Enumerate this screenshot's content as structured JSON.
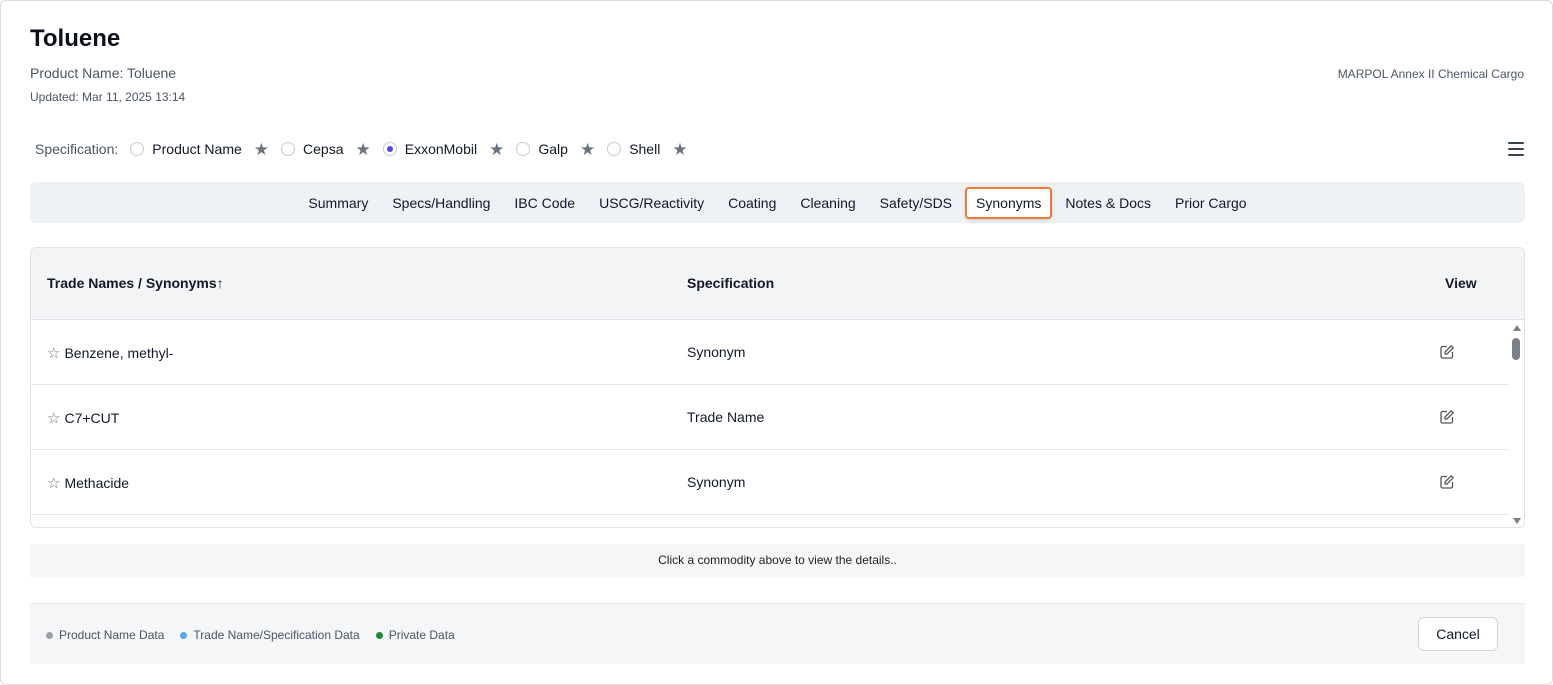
{
  "header": {
    "title": "Toluene",
    "product_name": "Product Name: Toluene",
    "updated": "Updated: Mar 11, 2025 13:14",
    "category": "MARPOL Annex II Chemical Cargo"
  },
  "specification": {
    "label": "Specification:",
    "options": [
      {
        "label": "Product Name",
        "checked": false
      },
      {
        "label": "Cepsa",
        "checked": false
      },
      {
        "label": "ExxonMobil",
        "checked": true
      },
      {
        "label": "Galp",
        "checked": false
      },
      {
        "label": "Shell",
        "checked": false
      }
    ]
  },
  "tabs": [
    {
      "label": "Summary"
    },
    {
      "label": "Specs/Handling"
    },
    {
      "label": "IBC Code"
    },
    {
      "label": "USCG/Reactivity"
    },
    {
      "label": "Coating"
    },
    {
      "label": "Cleaning"
    },
    {
      "label": "Safety/SDS"
    },
    {
      "label": "Synonyms",
      "active": true
    },
    {
      "label": "Notes & Docs"
    },
    {
      "label": "Prior Cargo"
    }
  ],
  "table": {
    "columns": [
      "Trade Names / Synonyms↑",
      "Specification",
      "View"
    ],
    "rows": [
      {
        "name": "Benzene, methyl-",
        "spec": "Synonym"
      },
      {
        "name": "C7+CUT",
        "spec": "Trade Name"
      },
      {
        "name": "Methacide",
        "spec": "Synonym"
      }
    ]
  },
  "hint": "Click a commodity above to view the details..",
  "legend": [
    {
      "label": "Product Name Data",
      "color": "#9aa0ab"
    },
    {
      "label": "Trade Name/Specification Data",
      "color": "#5aa4e8"
    },
    {
      "label": "Private Data",
      "color": "#1e8a3c"
    }
  ],
  "footer": {
    "cancel_label": "Cancel"
  },
  "colors": {
    "accent": "#4f46e5",
    "active_tab_border": "#ee7a36"
  }
}
